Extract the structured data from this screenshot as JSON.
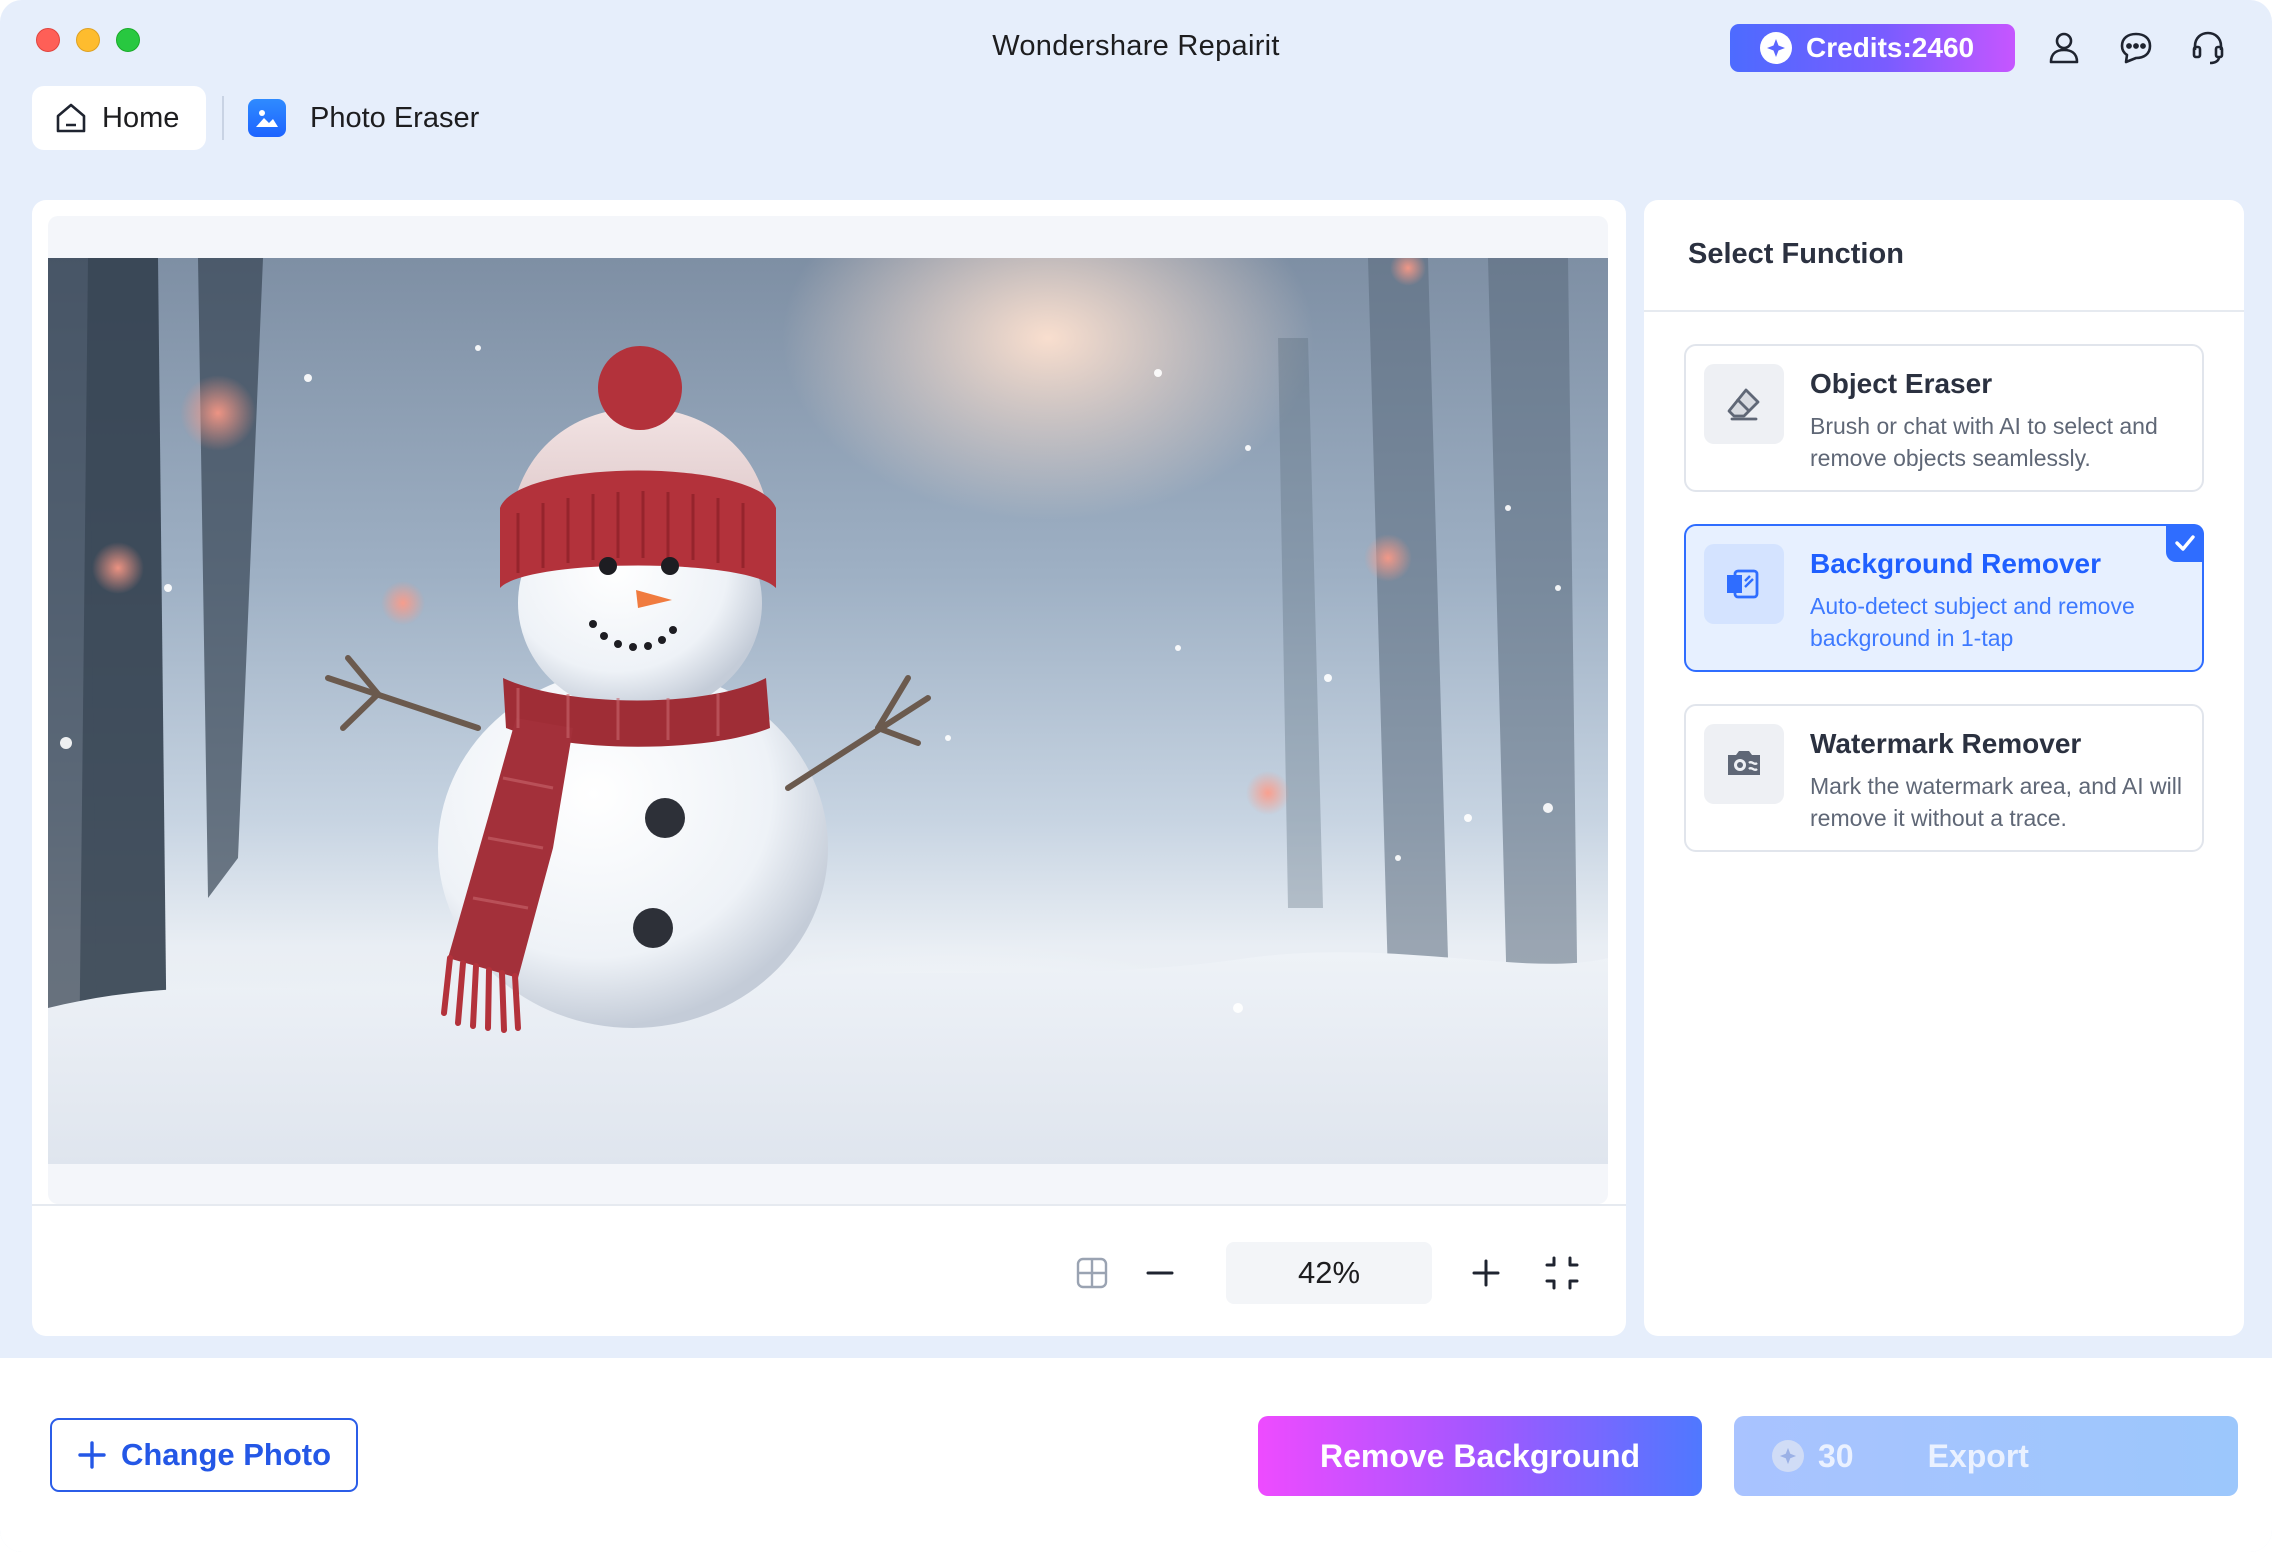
{
  "window": {
    "title": "Wondershare Repairit"
  },
  "header": {
    "credits_label": "Credits:2460",
    "icons": [
      "account-icon",
      "feedback-icon",
      "support-icon"
    ]
  },
  "nav": {
    "home_label": "Home",
    "current_label": "Photo Eraser"
  },
  "canvas": {
    "zoom": "42%",
    "image_subject": "snowman in snowy forest"
  },
  "function_panel": {
    "title": "Select Function",
    "items": [
      {
        "title": "Object Eraser",
        "desc": "Brush or chat with AI to select and remove objects seamlessly.",
        "selected": false
      },
      {
        "title": "Background Remover",
        "desc": "Auto-detect subject and remove background in 1-tap",
        "selected": true
      },
      {
        "title": "Watermark Remover",
        "desc": "Mark the watermark area, and AI will remove it without a trace.",
        "selected": false
      }
    ]
  },
  "footer": {
    "change_photo_label": "Change Photo",
    "remove_background_label": "Remove Background",
    "export_cost": "30",
    "export_label": "Export"
  },
  "colors": {
    "accent": "#2f6dff",
    "window_bg": "#e6eefb",
    "remove_gradient_start": "#ee4bff",
    "remove_gradient_end": "#4f78ff"
  }
}
